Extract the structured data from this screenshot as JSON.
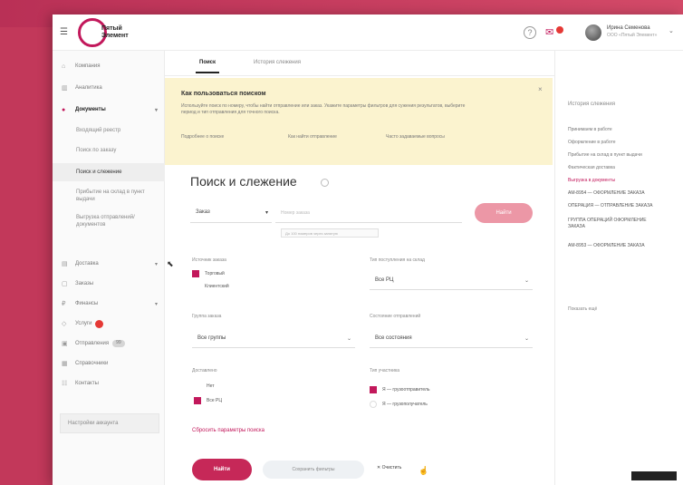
{
  "brand": {
    "logo_text": "Пятый Элемент",
    "accent": "#c2185b"
  },
  "header": {
    "help": "?",
    "user_name": "Ирина Семенова",
    "user_role": "ООО «Пятый Элемент»"
  },
  "sidebar": {
    "items": [
      {
        "label": "Компания",
        "icon": "home-icon"
      },
      {
        "label": "Аналитика",
        "icon": "chart-icon"
      },
      {
        "label": "Документы",
        "icon": "document-icon",
        "active": true
      },
      {
        "label": "Доставка",
        "icon": "truck-icon"
      },
      {
        "label": "Заказы",
        "icon": "cart-icon"
      },
      {
        "label": "Финансы",
        "icon": "wallet-icon"
      },
      {
        "label": "Услуги",
        "icon": "box-icon"
      },
      {
        "label": "Отправления",
        "icon": "send-icon",
        "badge": "99"
      },
      {
        "label": "Справочники",
        "icon": "book-icon"
      },
      {
        "label": "Контакты",
        "icon": "contacts-icon"
      }
    ],
    "subitems": [
      "Входящий реестр",
      "Поиск по заказу",
      "Поиск и слежение",
      "Прибытие на склад в пункт выдачи",
      "Выгрузка отправлений/документов"
    ],
    "bottom": "Настройки аккаунта"
  },
  "tabs": [
    {
      "label": "Поиск",
      "active": true
    },
    {
      "label": "История слежения",
      "active": false
    }
  ],
  "banner": {
    "title": "Как пользоваться поиском",
    "text": "Используйте поиск по номеру, чтобы найти отправление или заказ. Укажите параметры фильтров для сужения результатов, выберите период и тип отправления для точного поиска.",
    "links": [
      "Подробнее о поиске",
      "Как найти отправление",
      "Часто задаваемые вопросы"
    ],
    "close": "×"
  },
  "main": {
    "title": "Поиск и слежение",
    "type_select": "Заказ",
    "search_placeholder": "Номер заказа",
    "search_hint": "До 100 номеров через запятую",
    "find_top": "Найти",
    "filters": {
      "source_label": "Источник заказа",
      "source_options": [
        {
          "label": "Торговый",
          "checked": true
        },
        {
          "label": "Клиентский",
          "checked": false
        }
      ],
      "delivery_label": "Тип поступления на склад",
      "delivery_value": "Все РЦ",
      "group_label": "Группа заказа",
      "group_value": "Все группы",
      "status_label": "Состояние отправлений",
      "status_value": "Все состояния",
      "paid_label": "Доставлено",
      "paid_options": [
        {
          "label": "Нет",
          "checked": false
        },
        {
          "label": "Все РЦ",
          "checked": true
        }
      ],
      "participants_label": "Тип участника",
      "participants_options": [
        {
          "label": "Я — грузоотправитель",
          "checked": true
        },
        {
          "label": "Я — грузополучатель",
          "checked": false
        }
      ]
    },
    "reset": "Сбросить параметры поиска",
    "find_button": "Найти",
    "save_button": "Сохранить фильтры",
    "clear_button": "Очистить"
  },
  "right_panel": {
    "title": "История слежения",
    "items": [
      "Принимаем в работе",
      "Оформление в работе",
      "Прибытие на склад в пункт выдачи",
      "Фактическая доставка",
      "Выгрузка в документы",
      "AM-8954 — ОФОРМЛЕНИЕ ЗАКАЗА",
      "ОПЕРАЦИЯ — ОТПРАВЛЕНИЕ ЗАКАЗА",
      "ГРУППА ОПЕРАЦИЙ ОФОРМЛЕНИЕ ЗАКАЗА",
      "AM-8953 — ОФОРМЛЕНИЕ ЗАКАЗА"
    ],
    "more": "Показать ещё"
  }
}
